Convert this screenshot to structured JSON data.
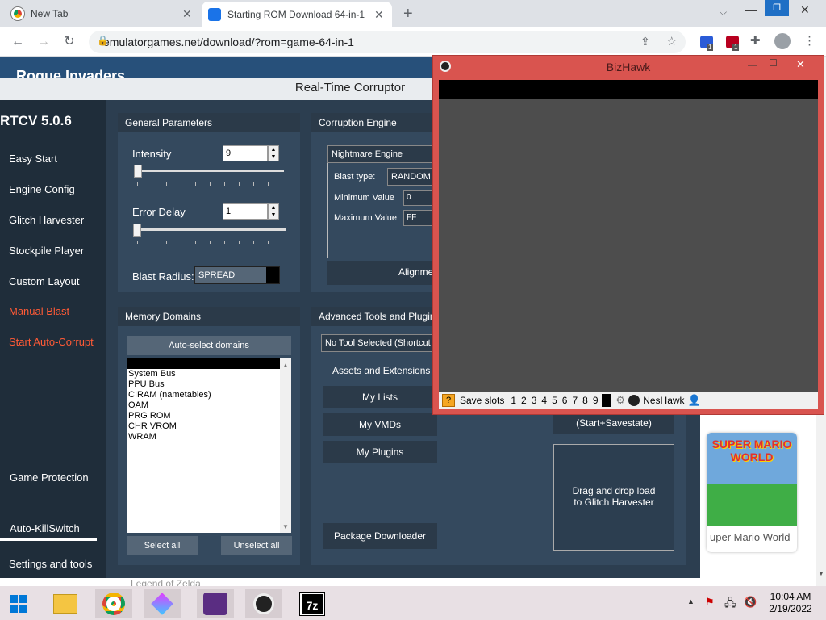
{
  "browser": {
    "tabs": [
      {
        "title": "New Tab"
      },
      {
        "title": "Starting ROM Download 64-in-1"
      }
    ],
    "url": "emulatorgames.net/download/?rom=game-64-in-1",
    "ext_badges": [
      "1",
      "1"
    ]
  },
  "page": {
    "header_text": "Rogue Invaders",
    "card_title": "uper Mario World",
    "card_logo": "SUPER MARIO WORLD",
    "below_text": "Legend of Zelda"
  },
  "rtc": {
    "window_title": "Real-Time Corruptor",
    "version": "RTCV 5.0.6",
    "sidebar": [
      {
        "label": "Easy Start"
      },
      {
        "label": "Engine Config"
      },
      {
        "label": "Glitch Harvester"
      },
      {
        "label": "Stockpile Player"
      },
      {
        "label": "Custom Layout"
      },
      {
        "label": "Manual Blast"
      },
      {
        "label": "Start Auto-Corrupt"
      },
      {
        "label": "Game Protection"
      },
      {
        "label": "Auto-KillSwitch"
      },
      {
        "label": "Settings and tools"
      }
    ],
    "general": {
      "heading": "General Parameters",
      "intensity_label": "Intensity",
      "intensity_value": "9",
      "error_delay_label": "Error Delay",
      "error_delay_value": "1",
      "blast_radius_label": "Blast Radius:",
      "blast_radius_value": "SPREAD"
    },
    "engine": {
      "heading": "Corruption Engine",
      "selected": "Nightmare Engine",
      "blast_type_label": "Blast type:",
      "blast_type_value": "RANDOM",
      "min_label": "Minimum Value",
      "min_value": "0",
      "max_label": "Maximum Value",
      "max_value": "FF",
      "alignment_label": "Alignme"
    },
    "memory": {
      "heading": "Memory Domains",
      "auto_select": "Auto-select domains",
      "domains": [
        "System Bus",
        "PPU Bus",
        "CIRAM (nametables)",
        "OAM",
        "PRG ROM",
        "CHR VROM",
        "WRAM"
      ],
      "select_all": "Select all",
      "unselect_all": "Unselect all"
    },
    "tools": {
      "heading": "Advanced Tools and Plugin",
      "selected": "No Tool Selected (Shortcut",
      "assets_label": "Assets and Extensions",
      "my_lists": "My Lists",
      "my_vmds": "My VMDs",
      "my_plugins": "My Plugins",
      "package_downloader": "Package Downloader",
      "start_savestate": "(Start+Savestate)",
      "drag_drop": "Drag and drop load to Glitch Harvester"
    }
  },
  "bizhawk": {
    "title": "BizHawk",
    "save_slots_label": "Save slots",
    "slots": [
      "1",
      "2",
      "3",
      "4",
      "5",
      "6",
      "7",
      "8",
      "9"
    ],
    "core": "NesHawk"
  },
  "taskbar": {
    "time": "10:04 AM",
    "date": "2/19/2022",
    "apps": [
      "file-explorer-icon",
      "chrome-icon",
      "gem-app-icon",
      "rtcv-app-icon",
      "bizhawk-app-icon",
      "7zip-icon"
    ]
  },
  "colors": {
    "rtc_bg": "#2c3e50",
    "rtc_sidebar": "#1f2d3a",
    "accent_red": "#ff5a36",
    "bizhawk_frame": "#d9544f"
  }
}
